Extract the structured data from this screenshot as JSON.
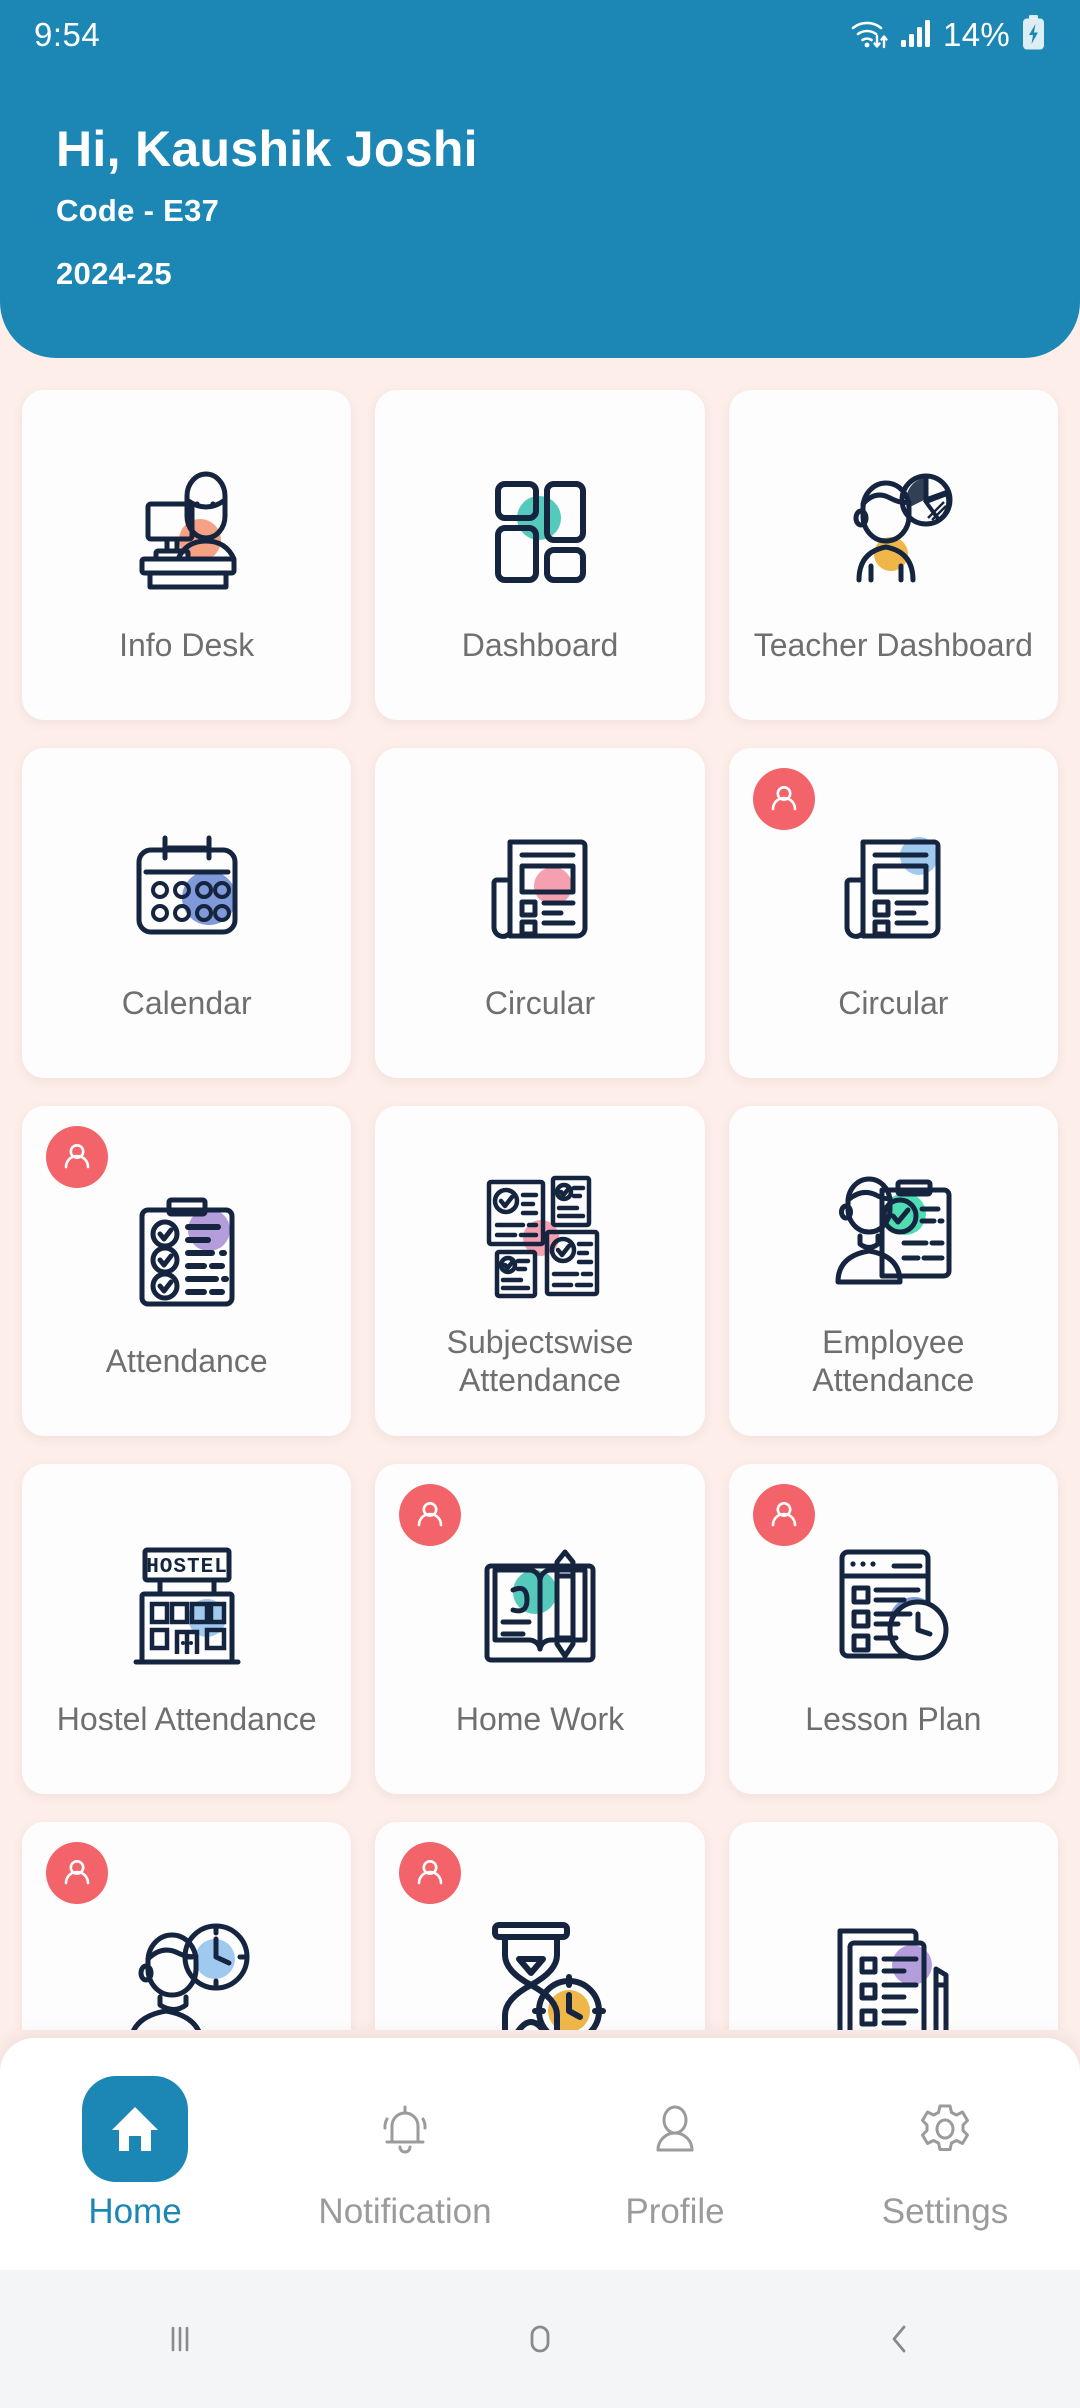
{
  "statusbar": {
    "time": "9:54",
    "battery_percent": "14%",
    "wifi_icon": "wifi-icon",
    "signal_icon": "signal-bars-icon",
    "battery_icon": "battery-charging-icon"
  },
  "header": {
    "greeting": "Hi, Kaushik  Joshi",
    "code": "Code - E37",
    "session": "2024-25",
    "background_color": "#1c87b4"
  },
  "colors": {
    "page_background": "#fdeeea",
    "tile_background": "#fdfdfd",
    "icon_stroke": "#16253f",
    "label_text": "#6f6f6f",
    "badge": "#f2646a",
    "accent_teal": "#55c9bc",
    "accent_amber": "#efb749",
    "accent_periwinkle": "#7f99d9",
    "accent_pink": "#f5a0b0",
    "accent_lightblue": "#9fc9ef",
    "accent_purple": "#b39ddb",
    "accent_mint": "#4fddb4",
    "accent_peach": "#f5a183"
  },
  "tiles": [
    {
      "label": "Info Desk",
      "icon": "info-desk-icon",
      "accent": "#f5a183",
      "badge": false
    },
    {
      "label": "Dashboard",
      "icon": "dashboard-grid-icon",
      "accent": "#55c9bc",
      "badge": false
    },
    {
      "label": "Teacher Dashboard",
      "icon": "teacher-dashboard-icon",
      "accent": "#efb749",
      "badge": false
    },
    {
      "label": "Calendar",
      "icon": "calendar-icon",
      "accent": "#7f99d9",
      "badge": false
    },
    {
      "label": "Circular",
      "icon": "circular-newspaper-icon",
      "accent": "#f5a0b0",
      "badge": false
    },
    {
      "label": "Circular",
      "icon": "circular-newspaper-icon",
      "accent": "#9fc9ef",
      "badge": true
    },
    {
      "label": "Attendance",
      "icon": "attendance-clipboard-icon",
      "accent": "#b39ddb",
      "badge": true
    },
    {
      "label": "Subjectswise Attendance",
      "icon": "subjectswise-documents-icon",
      "accent": "#f5a0b0",
      "badge": false
    },
    {
      "label": "Employee Attendance",
      "icon": "employee-attendance-icon",
      "accent": "#4fddb4",
      "badge": false
    },
    {
      "label": "Hostel Attendance",
      "icon": "hostel-building-icon",
      "accent": "#9fc9ef",
      "badge": false
    },
    {
      "label": "Home Work",
      "icon": "homework-book-pencil-icon",
      "accent": "#55c9bc",
      "badge": true
    },
    {
      "label": "Lesson Plan",
      "icon": "lesson-plan-clock-icon",
      "accent": "#7f99d9",
      "badge": true
    },
    {
      "label": "",
      "icon": "student-clock-icon",
      "accent": "#9fc9ef",
      "badge": true
    },
    {
      "label": "",
      "icon": "hourglass-clock-icon",
      "accent": "#efb749",
      "badge": true
    },
    {
      "label": "",
      "icon": "checklist-pen-icon",
      "accent": "#b39ddb",
      "badge": false
    }
  ],
  "hostel_sign_text": "HOSTEL",
  "bottom_nav": {
    "items": [
      {
        "label": "Home",
        "icon": "home-icon",
        "active": true
      },
      {
        "label": "Notification",
        "icon": "bell-icon",
        "active": false
      },
      {
        "label": "Profile",
        "icon": "person-icon",
        "active": false
      },
      {
        "label": "Settings",
        "icon": "gear-icon",
        "active": false
      }
    ]
  },
  "system_nav": {
    "recents": "recents-icon",
    "home": "system-home-icon",
    "back": "back-icon"
  }
}
